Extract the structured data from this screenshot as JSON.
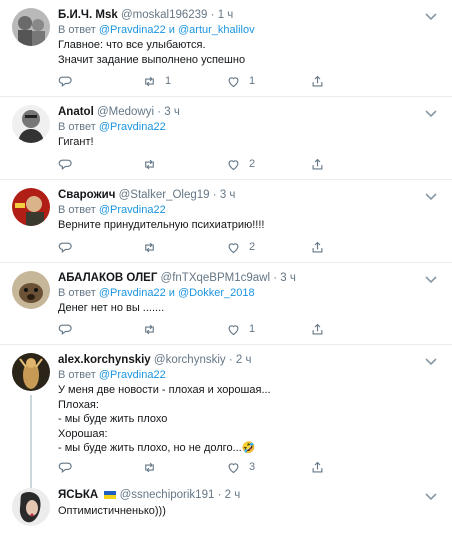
{
  "tweets": [
    {
      "name": "Б.И.Ч. Msk",
      "handle": "@moskal196239",
      "dot": "·",
      "time": "1 ч",
      "reply_prefix": "В ответ",
      "reply_user1": "@Pravdina22",
      "reply_and": "и",
      "reply_user2": "@artur_khalilov",
      "lines": [
        "Главное: что все улыбаются.",
        "Значит задание выполнено успешно"
      ],
      "reply_count": "",
      "retweet_count": "1",
      "like_count": "1"
    },
    {
      "name": "Anatol",
      "handle": "@Medowyi",
      "dot": "·",
      "time": "3 ч",
      "reply_prefix": "В ответ",
      "reply_user1": "@Pravdina22",
      "lines": [
        "Гигант!"
      ],
      "reply_count": "",
      "retweet_count": "",
      "like_count": "2"
    },
    {
      "name": "Сварожич",
      "handle": "@Stalker_Oleg19",
      "dot": "·",
      "time": "3 ч",
      "reply_prefix": "В ответ",
      "reply_user1": "@Pravdina22",
      "lines": [
        "Верните принудительную психиатрию!!!!"
      ],
      "reply_count": "",
      "retweet_count": "",
      "like_count": "2"
    },
    {
      "name": "АБАЛАКОВ ОЛЕГ",
      "handle": "@fnTXqeBPM1c9awl",
      "dot": "·",
      "time": "3 ч",
      "reply_prefix": "В ответ",
      "reply_user1": "@Pravdina22",
      "reply_and": "и",
      "reply_user2": "@Dokker_2018",
      "lines": [
        "Денег нет но вы ......."
      ],
      "reply_count": "",
      "retweet_count": "",
      "like_count": "1"
    },
    {
      "name": "alex.korchynskiy",
      "handle": "@korchynskiy",
      "dot": "·",
      "time": "2 ч",
      "reply_prefix": "В ответ",
      "reply_user1": "@Pravdina22",
      "lines": [
        "У меня две новости - плохая и хорошая...",
        "Плохая:",
        "- мы буде жить плохо",
        "Хорошая:",
        "- мы буде жить плохо, но не долго...🤣"
      ],
      "reply_count": "",
      "retweet_count": "",
      "like_count": "3"
    },
    {
      "name": "ЯСЬКА",
      "handle": "@ssnechiporik191",
      "dot": "·",
      "time": "2 ч",
      "lines": [
        "Оптимистичненько)))"
      ]
    }
  ],
  "colors": {
    "link": "#1b95e0",
    "muted": "#657786",
    "divider": "#e6ecf0"
  },
  "icons": [
    "reply-icon",
    "retweet-icon",
    "like-icon",
    "share-icon",
    "caret-down-icon"
  ]
}
